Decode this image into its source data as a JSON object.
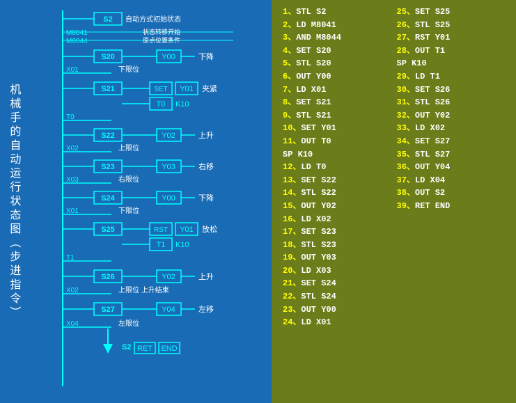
{
  "title": "机械手的自动运行状态图（步进指令）",
  "diagram": {
    "states": [
      "S2",
      "S20",
      "S21",
      "S22",
      "S23",
      "S24",
      "S25",
      "S26",
      "S27"
    ],
    "labels": {
      "S2": "自动方式初始状态",
      "state_transfer": "状态转移开始",
      "origin": "原点位置条件",
      "S20": {
        "output": "Y00",
        "action": "下降"
      },
      "X01_1": "下限位",
      "S21": {
        "set": "Y01",
        "timer": "T0",
        "value": "K10",
        "action": "夹紧"
      },
      "S22": {
        "output": "Y02",
        "action": "上升"
      },
      "X02_1": "上限位",
      "S23": {
        "output": "Y03",
        "action": "右移"
      },
      "X03": "右限位",
      "S24": {
        "output": "Y00",
        "action": "下降"
      },
      "X01_2": "下限位",
      "S25": {
        "rst": "Y01",
        "timer": "T1",
        "value": "K10",
        "action": "放松"
      },
      "S26": {
        "output": "Y02",
        "action": "上升"
      },
      "X02_2": "上限位上升结束",
      "S27": {
        "output": "Y04",
        "action": "左移"
      },
      "X04": "左限位"
    },
    "m_labels": [
      "M8041",
      "M8044"
    ],
    "bottom": {
      "s2": "S2",
      "ret": "RET",
      "end": "END"
    }
  },
  "code": {
    "col1": [
      {
        "num": "1、",
        "text": "STL S2"
      },
      {
        "num": "2、",
        "text": "LD  M8041"
      },
      {
        "num": "3、",
        "text": "AND M8044"
      },
      {
        "num": "4、",
        "text": "SET S20"
      },
      {
        "num": "5、",
        "text": "STL S20"
      },
      {
        "num": "6、",
        "text": "OUT Y00"
      },
      {
        "num": "7、",
        "text": "LD  X01"
      },
      {
        "num": "8、",
        "text": "SET S21"
      },
      {
        "num": "9、",
        "text": "STL S21"
      },
      {
        "num": "10、",
        "text": "SET Y01"
      },
      {
        "num": "11、",
        "text": "OUT T0"
      },
      {
        "num": "",
        "text": "   SP K10"
      },
      {
        "num": "12、",
        "text": "LD  T0"
      },
      {
        "num": "13、",
        "text": "SET S22"
      },
      {
        "num": "14、",
        "text": "STL S22"
      },
      {
        "num": "15、",
        "text": "OUT Y02"
      },
      {
        "num": "16、",
        "text": "LD  X02"
      },
      {
        "num": "17、",
        "text": "SET S23"
      },
      {
        "num": "18、",
        "text": "STL S23"
      },
      {
        "num": "19、",
        "text": "OUT Y03"
      },
      {
        "num": "20、",
        "text": "LD  X03"
      },
      {
        "num": "21、",
        "text": "SET S24"
      },
      {
        "num": "22、",
        "text": "STL S24"
      },
      {
        "num": "23、",
        "text": "OUT Y00"
      },
      {
        "num": "24、",
        "text": "LD  X01"
      }
    ],
    "col2": [
      {
        "num": "25、",
        "text": "SET S25"
      },
      {
        "num": "26、",
        "text": "STL S25"
      },
      {
        "num": "27、",
        "text": "RST Y01"
      },
      {
        "num": "28、",
        "text": "OUT T1"
      },
      {
        "num": "",
        "text": "   SP K10"
      },
      {
        "num": "29、",
        "text": "LD  T1"
      },
      {
        "num": "30、",
        "text": "SET S26"
      },
      {
        "num": "31、",
        "text": "STL S26"
      },
      {
        "num": "32、",
        "text": "OUT Y02"
      },
      {
        "num": "33、",
        "text": "LD  X02"
      },
      {
        "num": "34、",
        "text": "SET S27"
      },
      {
        "num": "35、",
        "text": "STL S27"
      },
      {
        "num": "36、",
        "text": "OUT Y04"
      },
      {
        "num": "37、",
        "text": "LD  X04"
      },
      {
        "num": "38、",
        "text": "OUT S2"
      },
      {
        "num": "39、",
        "text": "RET END"
      }
    ]
  }
}
